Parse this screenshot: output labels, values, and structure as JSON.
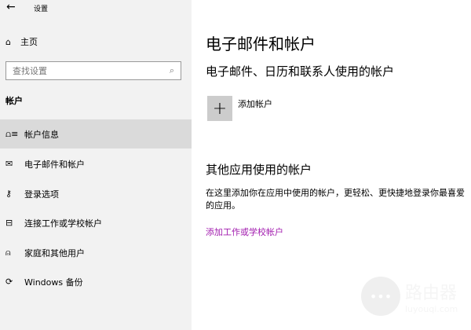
{
  "window": {
    "title": "设置",
    "back_icon": "arrow-left-icon"
  },
  "sidebar": {
    "home": "主页",
    "search_placeholder": "查找设置",
    "section": "帐户",
    "items": [
      {
        "label": "帐户信息",
        "icon": "account-info-icon"
      },
      {
        "label": "电子邮件和帐户",
        "icon": "mail-icon"
      },
      {
        "label": "登录选项",
        "icon": "key-icon"
      },
      {
        "label": "连接工作或学校帐户",
        "icon": "briefcase-icon"
      },
      {
        "label": "家庭和其他用户",
        "icon": "add-person-icon"
      },
      {
        "label": "Windows 备份",
        "icon": "sync-icon"
      }
    ]
  },
  "main": {
    "title": "电子邮件和帐户",
    "section1": "电子邮件、日历和联系人使用的帐户",
    "add_account": "添加帐户",
    "section2": "其他应用使用的帐户",
    "description": "在这里添加你在应用中使用的帐户，更轻松、更快捷地登录你最喜爱的应用。",
    "add_work_link": "添加工作或学校帐户"
  },
  "watermark": {
    "title": "路由器",
    "subtitle": "luyouqi.com"
  },
  "colors": {
    "link": "#a21caf",
    "selected": "#dadada",
    "sidebar": "#f2f2f2"
  }
}
